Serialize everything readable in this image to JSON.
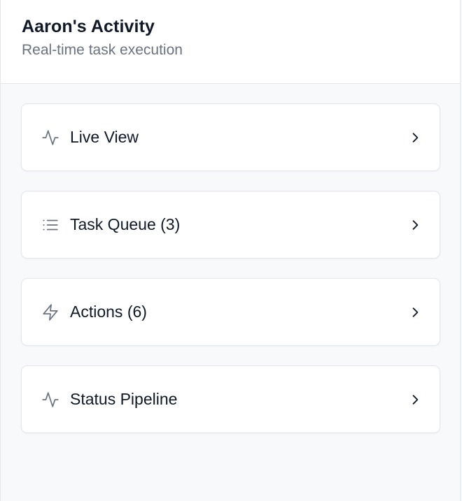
{
  "header": {
    "title": "Aaron's Activity",
    "subtitle": "Real-time task execution"
  },
  "items": [
    {
      "label": "Live View",
      "icon": "activity-icon"
    },
    {
      "label": "Task Queue (3)",
      "icon": "list-icon"
    },
    {
      "label": "Actions (6)",
      "icon": "lightning-icon"
    },
    {
      "label": "Status Pipeline",
      "icon": "activity-icon"
    }
  ],
  "colors": {
    "icon": "#6b7280",
    "text": "#111827",
    "subtitle": "#6b7280",
    "background": "#f8f9fb"
  }
}
